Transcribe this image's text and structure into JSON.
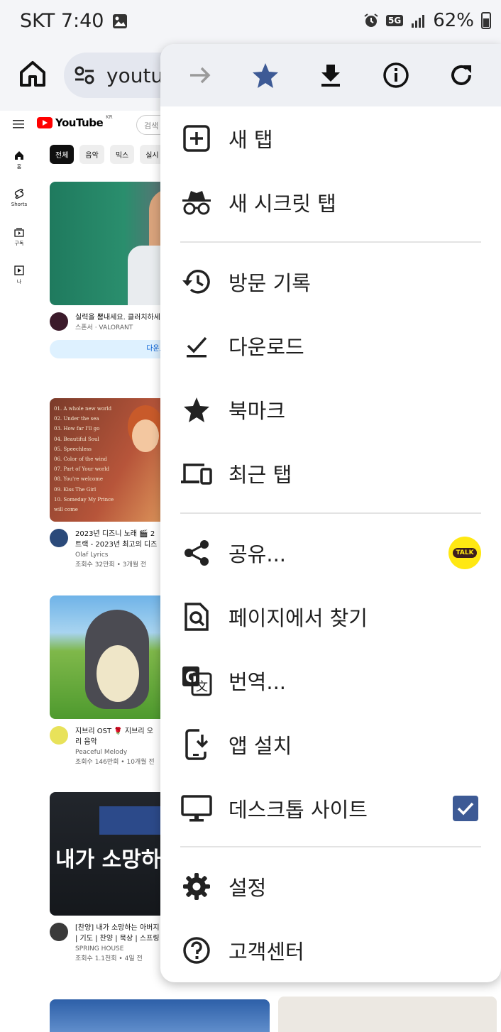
{
  "status_bar": {
    "carrier_time": "SKT 7:40",
    "network_badge": "5G",
    "battery": "62%"
  },
  "toolbar": {
    "url": "youtu",
    "home_icon": "home-icon",
    "tune_icon": "site-settings-icon"
  },
  "youtube": {
    "logo": "YouTube",
    "region": "KR",
    "search_placeholder": "검색",
    "rail": [
      {
        "label": "홈",
        "icon": "home-icon"
      },
      {
        "label": "Shorts",
        "icon": "shorts-icon"
      },
      {
        "label": "구독",
        "icon": "subscriptions-icon"
      },
      {
        "label": "나",
        "icon": "library-icon"
      }
    ],
    "chips": [
      "전체",
      "음악",
      "믹스",
      "실시"
    ],
    "videos": [
      {
        "title": "실력을 뽐내세요. 클러치하세요",
        "line2": "",
        "channel": "스폰서 · VALORANT",
        "stats": "",
        "button": "다운로"
      },
      {
        "title": "2023년 디즈니 노래 🎬 2",
        "line2": "트랙 - 2023년 최고의 디즈",
        "channel": "Olaf Lyrics",
        "stats": "조회수 32만회 • 3개월 전",
        "thumb_lines": [
          "01. A whole new world",
          "02. Under the sea",
          "03. How far I'll go",
          "04. Beautiful Soul",
          "05. Speechless",
          "06. Color of the wind",
          "07. Part of Your world",
          "08. You're welcome",
          "09. Kiss The Girl",
          "10. Someday My Prince",
          "will come"
        ]
      },
      {
        "title": "지브리 OST 🌹 지브리 오",
        "line2": "리 음악",
        "channel": "Peaceful Melody",
        "stats": "조회수 146만회 • 10개월 전"
      },
      {
        "title": "[찬양] 내가 소망하는 아버지",
        "line2": "| 기도 | 찬양 | 묵상 | 스프링",
        "channel": "SPRING HOUSE",
        "stats": "조회수 1.1천회 • 4일 전",
        "thumb_text": "내가 소망하는"
      }
    ]
  },
  "menu": {
    "top_icons": [
      "forward-icon",
      "bookmark-star-icon",
      "download-icon",
      "info-icon",
      "reload-icon"
    ],
    "items": [
      {
        "label": "새 탭",
        "icon": "new-tab-icon"
      },
      {
        "label": "새 시크릿 탭",
        "icon": "incognito-icon"
      },
      {
        "label": "방문 기록",
        "icon": "history-icon"
      },
      {
        "label": "다운로드",
        "icon": "downloads-icon"
      },
      {
        "label": "북마크",
        "icon": "bookmarks-icon"
      },
      {
        "label": "최근 탭",
        "icon": "recent-tabs-icon"
      },
      {
        "label": "공유...",
        "icon": "share-icon"
      },
      {
        "label": "페이지에서 찾기",
        "icon": "find-in-page-icon"
      },
      {
        "label": "번역...",
        "icon": "translate-icon"
      },
      {
        "label": "앱 설치",
        "icon": "install-app-icon"
      },
      {
        "label": "데스크톱 사이트",
        "icon": "desktop-site-icon"
      },
      {
        "label": "설정",
        "icon": "settings-icon"
      },
      {
        "label": "고객센터",
        "icon": "help-icon"
      }
    ],
    "kakao_badge": "TALK",
    "desktop_site_checked": true
  },
  "colors": {
    "accent": "#3d5a95",
    "youtube_red": "#ff0000",
    "menu_header_bg": "#eef0f4"
  }
}
